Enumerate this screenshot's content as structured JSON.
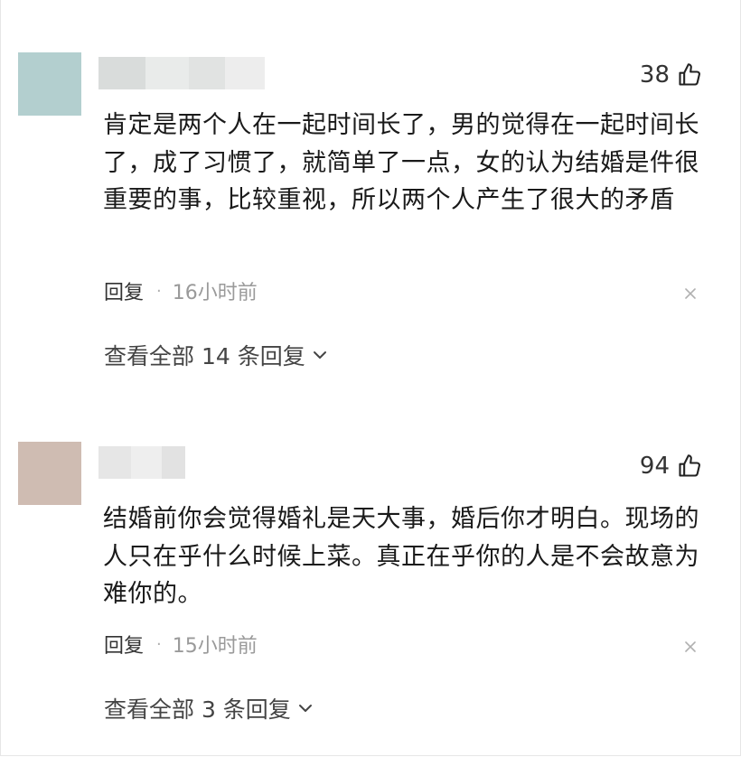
{
  "colors": {
    "avatar_1": "#b3cfcf",
    "avatar_2": "#cfbcb2",
    "username_blur": "#e3e3e3"
  },
  "comments": [
    {
      "like_count": "38",
      "text": "肯定是两个人在一起时间长了，男的觉得在一起时间长了，成了习惯了，就简单了一点，女的认为结婚是件很重要的事，比较重视，所以两个人产生了很大的矛盾",
      "reply_label": "回复",
      "separator": "·",
      "time": "16小时前",
      "view_replies": "查看全部 14 条回复"
    },
    {
      "like_count": "94",
      "text": "结婚前你会觉得婚礼是天大事，婚后你才明白。现场的人只在乎什么时候上菜。真正在乎你的人是不会故意为难你的。",
      "reply_label": "回复",
      "separator": "·",
      "time": "15小时前",
      "view_replies": "查看全部 3 条回复"
    }
  ],
  "icons": {
    "like": "thumbs-up-icon",
    "dismiss": "close-icon",
    "expand": "chevron-down-icon"
  }
}
